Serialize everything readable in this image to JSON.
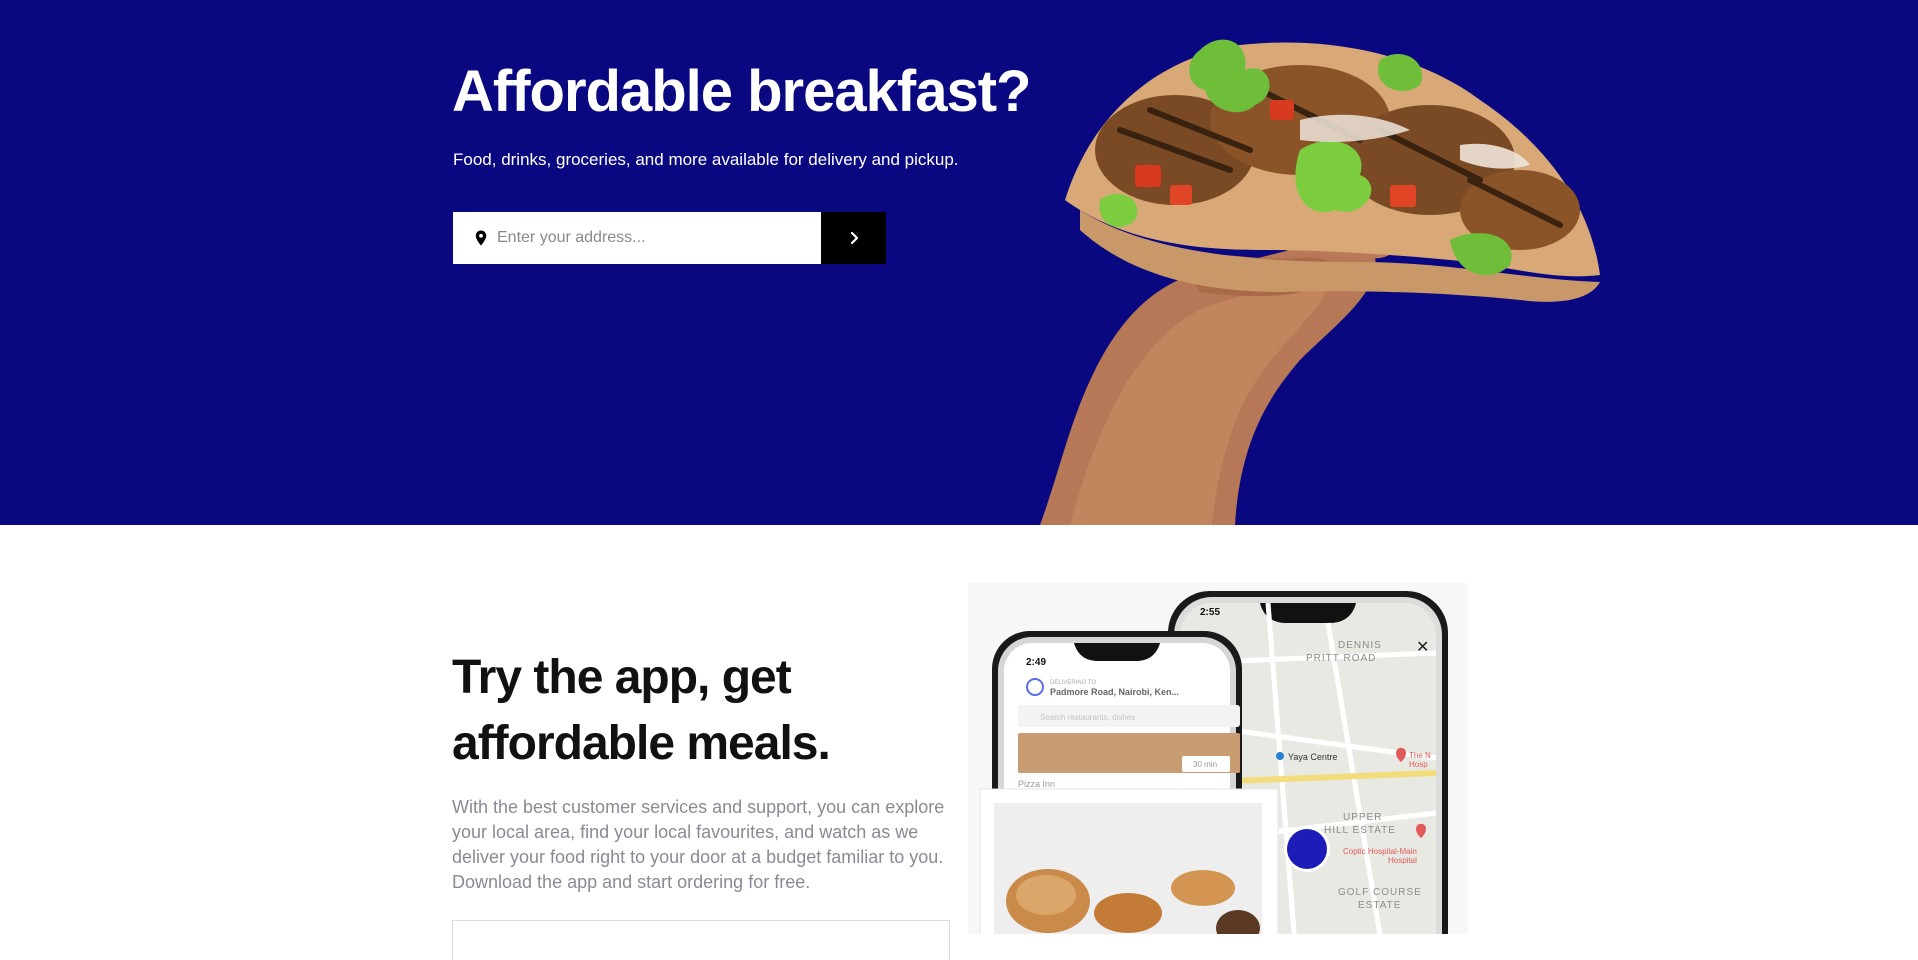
{
  "hero": {
    "title": "Affordable breakfast?",
    "subtitle": "Food, drinks, groceries, and more available for delivery and pickup.",
    "address_placeholder": "Enter your address...",
    "background_color": "#0a0880"
  },
  "app_section": {
    "title": "Try the app, get affordable meals.",
    "description": "With the best customer services and support, you can explore your local area, find your local favourites, and watch as we deliver your food right to your door at a budget familiar to you. Download the app and start ordering for free."
  },
  "phone_back": {
    "time": "2:55",
    "map_labels": [
      "DENNIS",
      "PRITT ROAD",
      "Yaya Centre",
      "UPPER",
      "HILL ESTATE",
      "Coptic Hospital-Main Hospital",
      "GOLF COURSE",
      "ESTATE",
      "The N Hosp"
    ]
  },
  "phone_front": {
    "time": "2:49",
    "delivering_to_label": "DELIVERING TO",
    "address": "Padmore Road, Nairobi, Ken...",
    "search_placeholder": "Search restaurants, dishes",
    "eta": "30 min",
    "restaurant": "Pizza Inn"
  },
  "icons": {
    "pin": "map-pin-icon",
    "go": "chevron-right-icon",
    "close": "close-icon"
  }
}
